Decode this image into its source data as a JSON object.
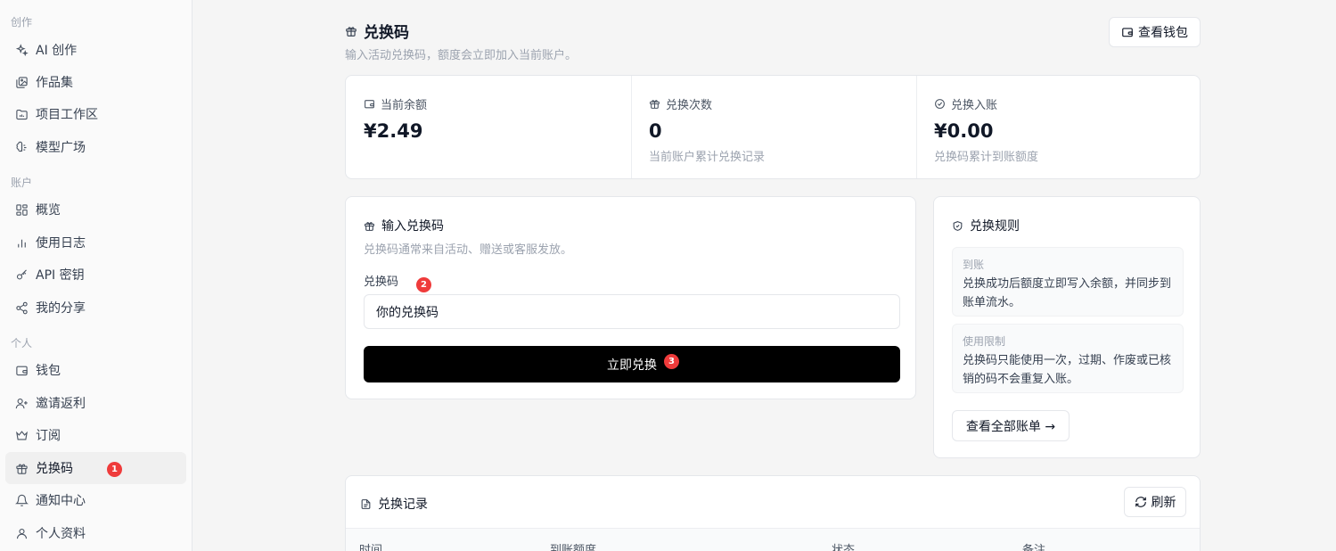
{
  "sidebar": {
    "sections": [
      "创作",
      "账户",
      "个人"
    ],
    "items": [
      {
        "label": "AI 创作",
        "icon": "sparkles-icon"
      },
      {
        "label": "作品集",
        "icon": "gallery-icon"
      },
      {
        "label": "项目工作区",
        "icon": "folder-icon"
      },
      {
        "label": "模型广场",
        "icon": "brain-icon"
      },
      {
        "label": "概览",
        "icon": "grid-icon"
      },
      {
        "label": "使用日志",
        "icon": "bar-chart-icon"
      },
      {
        "label": "API 密钥",
        "icon": "key-icon"
      },
      {
        "label": "我的分享",
        "icon": "share-icon"
      },
      {
        "label": "钱包",
        "icon": "wallet-icon"
      },
      {
        "label": "邀请返利",
        "icon": "user-plus-icon"
      },
      {
        "label": "订阅",
        "icon": "crown-icon"
      },
      {
        "label": "兑换码",
        "icon": "gift-icon",
        "active": true
      },
      {
        "label": "通知中心",
        "icon": "bell-icon"
      },
      {
        "label": "个人资料",
        "icon": "user-icon"
      }
    ]
  },
  "badges": [
    "1",
    "2",
    "3"
  ],
  "header": {
    "title": "兑换码",
    "subtitle": "输入活动兑换码，额度会立即加入当前账户。",
    "wallet_button": "查看钱包"
  },
  "stats": [
    {
      "label": "当前余额",
      "value": "¥2.49",
      "desc": ""
    },
    {
      "label": "兑换次数",
      "value": "0",
      "desc": "当前账户累计兑换记录"
    },
    {
      "label": "兑换入账",
      "value": "¥0.00",
      "desc": "兑换码累计到账额度"
    }
  ],
  "redeem": {
    "title": "输入兑换码",
    "subtitle": "兑换码通常来自活动、赠送或客服发放。",
    "field_label": "兑换码",
    "input_value": "你的兑换码",
    "submit": "立即兑换"
  },
  "rules": {
    "title": "兑换规则",
    "items": [
      {
        "title": "到账",
        "desc": "兑换成功后额度立即写入余额，并同步到账单流水。"
      },
      {
        "title": "使用限制",
        "desc": "兑换码只能使用一次，过期、作废或已核销的码不会重复入账。"
      }
    ],
    "all_bills": "查看全部账单 →"
  },
  "history": {
    "title": "兑换记录",
    "refresh": "刷新",
    "columns": [
      "时间",
      "到账额度",
      "状态",
      "备注"
    ]
  },
  "colors": {
    "badge": "#ef3b3b",
    "primary": "#000000",
    "background": "#f5f5f5"
  }
}
